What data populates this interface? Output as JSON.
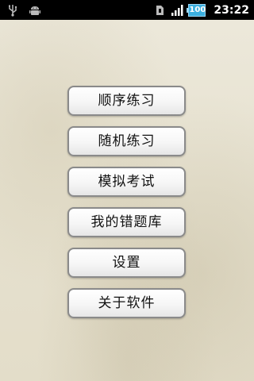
{
  "status_bar": {
    "icons_left": [
      "usb-icon",
      "android-debug-icon"
    ],
    "icons_right": [
      "sim-icon",
      "signal-icon",
      "battery-icon"
    ],
    "battery_level": "100",
    "time": "23:22",
    "battery_color": "#3cb0e0"
  },
  "menu": {
    "items": [
      {
        "label": "顺序练习"
      },
      {
        "label": "随机练习"
      },
      {
        "label": "模拟考试"
      },
      {
        "label": "我的错题库"
      },
      {
        "label": "设置"
      },
      {
        "label": "关于软件"
      }
    ]
  }
}
